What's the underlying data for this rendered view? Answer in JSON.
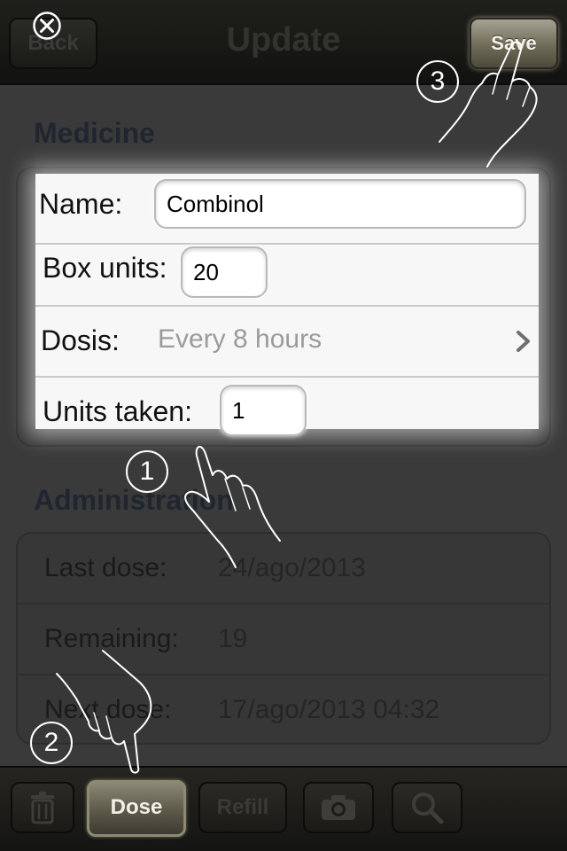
{
  "navbar": {
    "back_label": "Back",
    "title": "Update",
    "save_label": "Save"
  },
  "sections": {
    "medicine_header": "Medicine",
    "administration_header": "Administration"
  },
  "form": {
    "name_label": "Name:",
    "name_value": "Combinol",
    "box_units_label": "Box units:",
    "box_units_value": "20",
    "dosis_label": "Dosis:",
    "dosis_value": "Every 8 hours",
    "units_taken_label": "Units taken:",
    "units_taken_value": "1"
  },
  "administration": {
    "rows": [
      {
        "label": "Last dose:",
        "value": "24/ago/2013"
      },
      {
        "label": "Remaining:",
        "value": "19"
      },
      {
        "label": "Next dose:",
        "value": "17/ago/2013 04:32"
      }
    ]
  },
  "tabbar": {
    "trash_icon": "trash-icon",
    "dose_label": "Dose",
    "refill_label": "Refill",
    "camera_icon": "camera-icon",
    "search_icon": "search-icon"
  },
  "tutorial": {
    "close_icon": "close-circle-icon",
    "steps": [
      "1",
      "2",
      "3"
    ]
  },
  "colors": {
    "dim_background": "#3a3a3a",
    "form_background": "#f7f7f7",
    "active_button_gold": "#8c8876",
    "placeholder_gray": "#9b9b9b"
  }
}
